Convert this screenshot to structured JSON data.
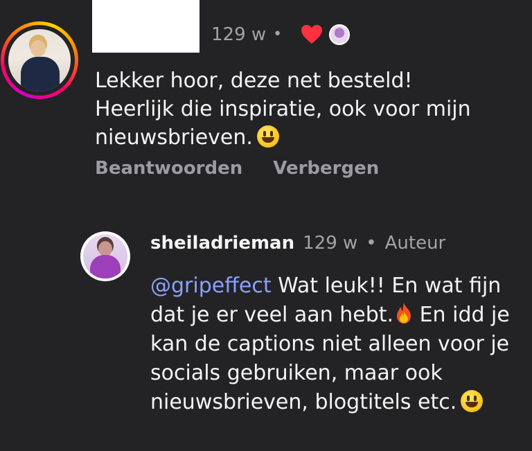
{
  "comment": {
    "time": "129 w",
    "separator": "•",
    "text_line1": "Lekker hoor, deze net besteld!",
    "text_line2": "Heerlijk die inspiratie, ook voor mijn",
    "text_line3": "nieuwsbrieven.",
    "emoji": "smiley-emoji",
    "reply_label": "Beantwoorden",
    "hide_label": "Verbergen",
    "liked_by_author": true,
    "heart_color": "#ff3040"
  },
  "reply": {
    "username": "sheiladrieman",
    "time": "129 w",
    "separator": "•",
    "badge": "Auteur",
    "mention": "@gripeffect",
    "text_part1": " Wat leuk!! En wat fijn dat je er veel aan hebt.",
    "text_part2": " En idd je kan de captions niet alleen voor je socials gebruiken, maar ook nieuwsbrieven, blogtitels etc.",
    "emoji1": "fire-emoji",
    "emoji2": "smiley-emoji",
    "mention_color": "#8aa2ff"
  }
}
